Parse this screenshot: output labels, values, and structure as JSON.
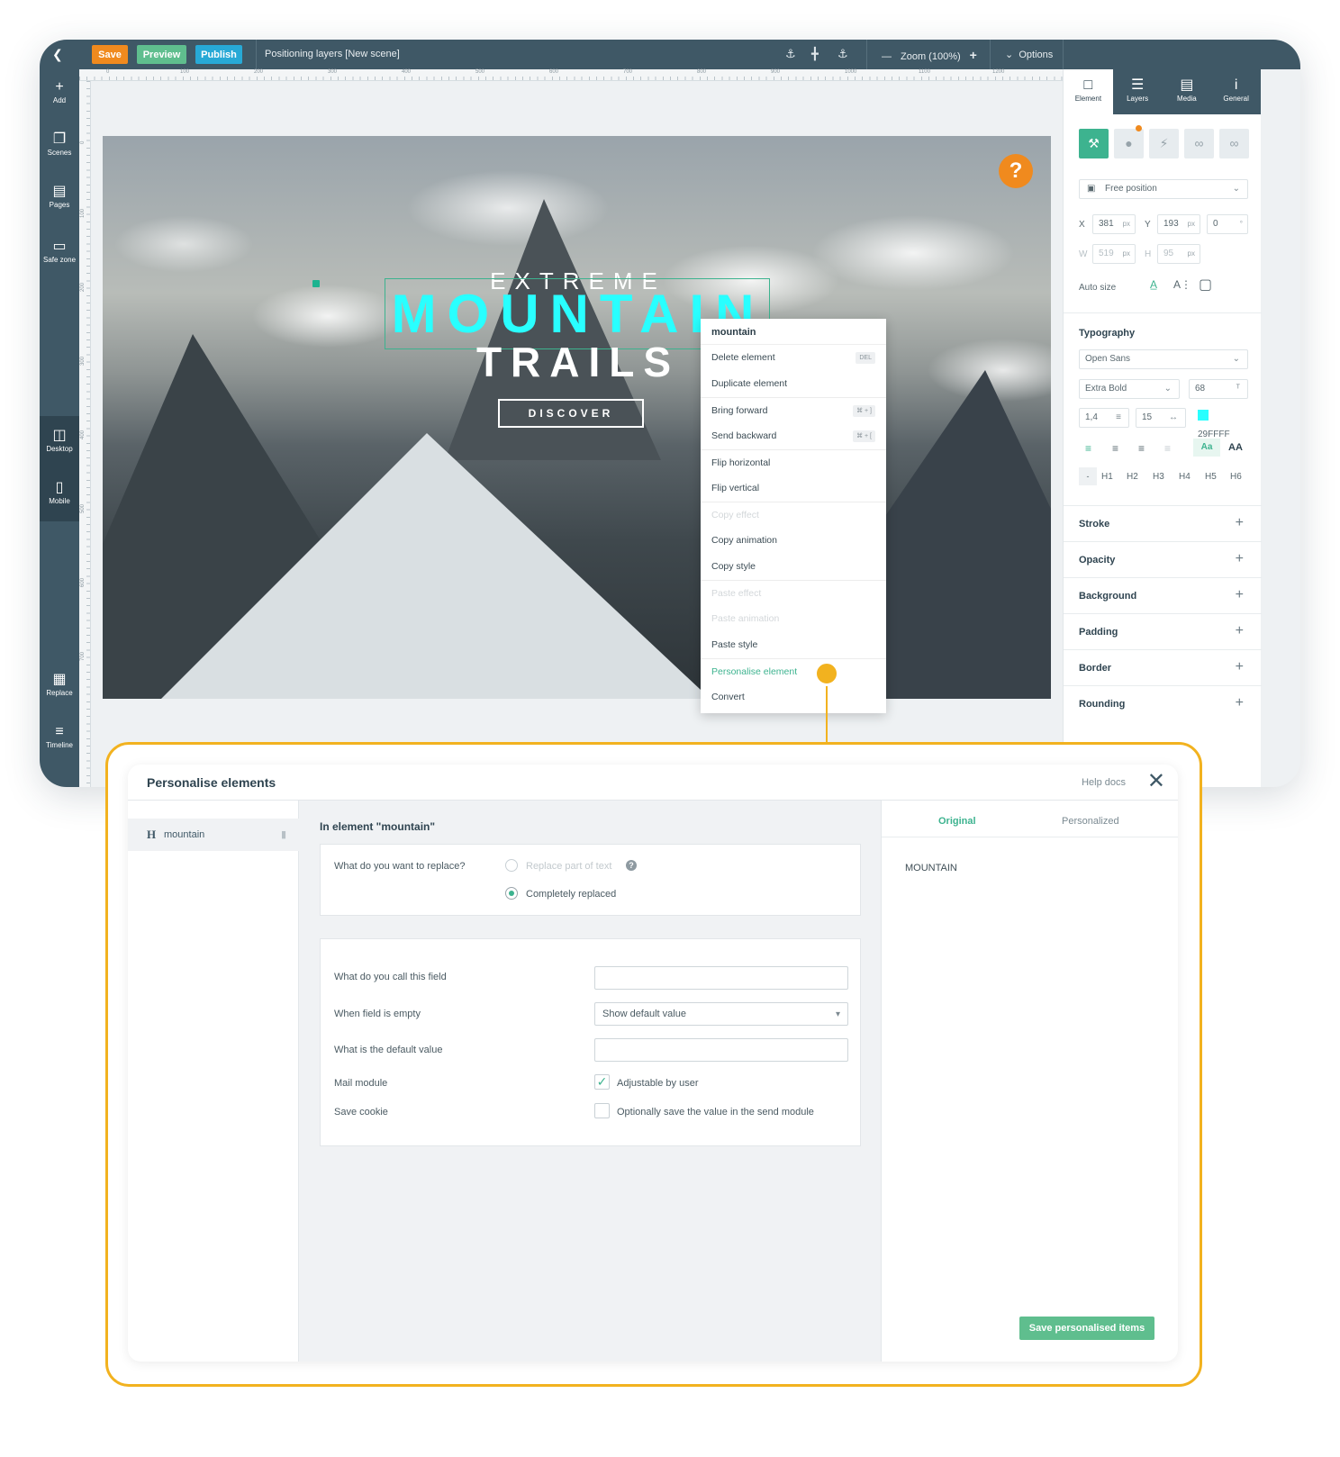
{
  "toolbar": {
    "back_icon": "chevron-left-icon",
    "save_label": "Save",
    "preview_label": "Preview",
    "publish_label": "Publish",
    "document_title": "Positioning layers [New scene]",
    "zoom_label": "Zoom (100%)",
    "options_label": "Options",
    "colors": {
      "save": "#f08a1e",
      "preview": "#5fbe8e",
      "publish": "#27a9d6",
      "bar": "#3f5866"
    }
  },
  "sidebar": {
    "items": [
      {
        "label": "Add",
        "icon": "plus-icon"
      },
      {
        "label": "Scenes",
        "icon": "scenes-icon"
      },
      {
        "label": "Pages",
        "icon": "book-icon"
      },
      {
        "label": "Safe zone",
        "icon": "safe-zone-icon"
      },
      {
        "label": "Desktop",
        "icon": "desktop-icon"
      },
      {
        "label": "Mobile",
        "icon": "mobile-icon"
      },
      {
        "label": "Replace",
        "icon": "replace-icon"
      },
      {
        "label": "Timeline",
        "icon": "timeline-icon"
      }
    ]
  },
  "ruler": {
    "top": [
      "0",
      "100",
      "200",
      "300",
      "400",
      "500",
      "600",
      "700",
      "800",
      "900",
      "1000",
      "1100",
      "1200"
    ],
    "left": [
      "0",
      "100",
      "200",
      "300",
      "400",
      "500",
      "600",
      "700"
    ]
  },
  "canvas": {
    "line1": "EXTREME",
    "line2": "MOUNTAIN",
    "line3": "TRAILS",
    "button": "DISCOVER",
    "help": "?"
  },
  "context_menu": {
    "title": "mountain",
    "items": [
      {
        "label": "Delete element",
        "shortcut": "DEL",
        "state": "normal"
      },
      {
        "label": "Duplicate element",
        "shortcut": "",
        "state": "normal"
      },
      {
        "label": "Bring forward",
        "shortcut": "⌘ + ]",
        "state": "normal"
      },
      {
        "label": "Send backward",
        "shortcut": "⌘ + [",
        "state": "normal"
      },
      {
        "label": "Flip horizontal",
        "shortcut": "",
        "state": "normal"
      },
      {
        "label": "Flip vertical",
        "shortcut": "",
        "state": "normal"
      },
      {
        "label": "Copy effect",
        "shortcut": "",
        "state": "disabled"
      },
      {
        "label": "Copy animation",
        "shortcut": "",
        "state": "normal"
      },
      {
        "label": "Copy style",
        "shortcut": "",
        "state": "normal"
      },
      {
        "label": "Paste effect",
        "shortcut": "",
        "state": "disabled"
      },
      {
        "label": "Paste animation",
        "shortcut": "",
        "state": "disabled"
      },
      {
        "label": "Paste style",
        "shortcut": "",
        "state": "normal"
      },
      {
        "label": "Personalise element",
        "shortcut": "",
        "state": "accent"
      },
      {
        "label": "Convert",
        "shortcut": "",
        "state": "normal"
      }
    ]
  },
  "panel": {
    "tabs": [
      {
        "label": "Element",
        "icon": "element-icon"
      },
      {
        "label": "Layers",
        "icon": "layers-icon"
      },
      {
        "label": "Media",
        "icon": "media-icon"
      },
      {
        "label": "General",
        "icon": "info-icon"
      }
    ],
    "position_mode": "Free position",
    "x_label": "X",
    "x": "381",
    "x_unit": "px",
    "y_label": "Y",
    "y": "193",
    "y_unit": "px",
    "rotation": "0",
    "rotation_unit": "°",
    "w_label": "W",
    "w": "519",
    "w_unit": "px",
    "h_label": "H",
    "h": "95",
    "h_unit": "px",
    "auto_size": "Auto size",
    "typography_title": "Typography",
    "font": "Open Sans",
    "weight": "Extra Bold",
    "size": "68",
    "line_height": "1,4",
    "letter_spacing": "15",
    "color_hex": "29FFFF",
    "case_lower": "Aa",
    "case_upper": "AA",
    "heading_none": "-",
    "headings": [
      "H1",
      "H2",
      "H3",
      "H4",
      "H5",
      "H6"
    ],
    "sections": [
      "Stroke",
      "Opacity",
      "Background",
      "Padding",
      "Border",
      "Rounding"
    ]
  },
  "dialog": {
    "title": "Personalise elements",
    "help": "Help docs",
    "element_label": "mountain",
    "element_prefix": "H",
    "section_title": "In element \"mountain\"",
    "replace_question": "What do you want to replace?",
    "replace_part": "Replace part of text",
    "replace_full": "Completely replaced",
    "field_name_label": "What do you call this field",
    "field_name_value": "",
    "empty_label": "When field is empty",
    "empty_value": "Show default value",
    "default_label": "What is the default value",
    "default_value": "",
    "mail_label": "Mail module",
    "mail_option": "Adjustable by user",
    "cookie_label": "Save cookie",
    "cookie_option": "Optionally save the value in the send module",
    "tab_original": "Original",
    "tab_personalized": "Personalized",
    "preview_text": "MOUNTAIN",
    "save_button": "Save personalised items"
  }
}
